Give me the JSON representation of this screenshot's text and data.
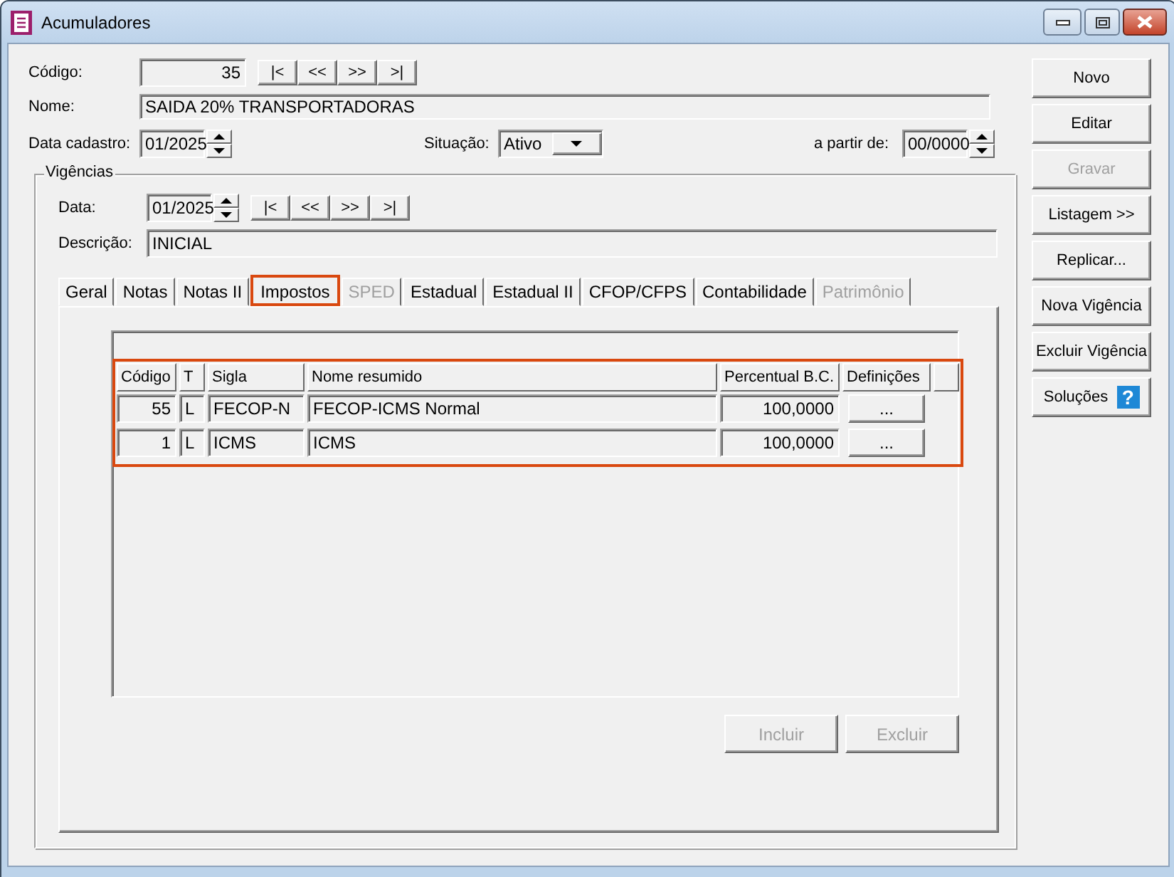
{
  "window": {
    "title": "Acumuladores"
  },
  "form": {
    "codigo": {
      "label": "Código:",
      "value": "35"
    },
    "nav": [
      "|<",
      "<<",
      ">>",
      ">|"
    ],
    "nome": {
      "label": "Nome:",
      "value": "SAIDA 20% TRANSPORTADORAS"
    },
    "data_cadastro": {
      "label": "Data cadastro:",
      "value": "01/2025"
    },
    "situacao": {
      "label": "Situação:",
      "value": "Ativo"
    },
    "a_partir_de": {
      "label": "a partir de:",
      "value": "00/0000"
    }
  },
  "vigencias": {
    "title": "Vigências",
    "data": {
      "label": "Data:",
      "value": "01/2025"
    },
    "nav": [
      "|<",
      "<<",
      ">>",
      ">|"
    ],
    "descricao": {
      "label": "Descrição:",
      "value": "INICIAL"
    },
    "tabs": [
      {
        "label": "Geral",
        "selected": false,
        "disabled": false
      },
      {
        "label": "Notas",
        "selected": false,
        "disabled": false
      },
      {
        "label": "Notas II",
        "selected": false,
        "disabled": false
      },
      {
        "label": "Impostos",
        "selected": true,
        "disabled": false
      },
      {
        "label": "SPED",
        "selected": false,
        "disabled": true
      },
      {
        "label": "Estadual",
        "selected": false,
        "disabled": false
      },
      {
        "label": "Estadual II",
        "selected": false,
        "disabled": false
      },
      {
        "label": "CFOP/CFPS",
        "selected": false,
        "disabled": false
      },
      {
        "label": "Contabilidade",
        "selected": false,
        "disabled": false
      },
      {
        "label": "Patrimônio",
        "selected": false,
        "disabled": true
      }
    ],
    "table": {
      "highlighted": true,
      "columns": [
        "Código",
        "T",
        "Sigla",
        "Nome resumido",
        "Percentual B.C.",
        "Definições"
      ],
      "rows": [
        {
          "codigo": "55",
          "t": "L",
          "sigla": "FECOP-N",
          "nome": "FECOP-ICMS Normal",
          "percentual": "100,0000",
          "definicoes": "..."
        },
        {
          "codigo": "1",
          "t": "L",
          "sigla": "ICMS",
          "nome": "ICMS",
          "percentual": "100,0000",
          "definicoes": "..."
        }
      ]
    },
    "buttons": [
      {
        "label": "Incluir",
        "disabled": true
      },
      {
        "label": "Excluir",
        "disabled": true
      }
    ]
  },
  "side_buttons": [
    {
      "label": "Novo",
      "disabled": false,
      "kind": "plain"
    },
    {
      "label": "Editar",
      "disabled": false,
      "kind": "plain"
    },
    {
      "label": "Gravar",
      "disabled": true,
      "kind": "plain"
    },
    {
      "label": "Listagem >>",
      "disabled": false,
      "kind": "plain"
    },
    {
      "label": "Replicar...",
      "disabled": false,
      "kind": "plain"
    },
    {
      "label": "Nova Vigência",
      "disabled": false,
      "kind": "plain"
    },
    {
      "label": "Excluir Vigência",
      "disabled": false,
      "kind": "plain"
    },
    {
      "label": "Soluções",
      "disabled": false,
      "kind": "help",
      "icon": "?"
    }
  ]
}
